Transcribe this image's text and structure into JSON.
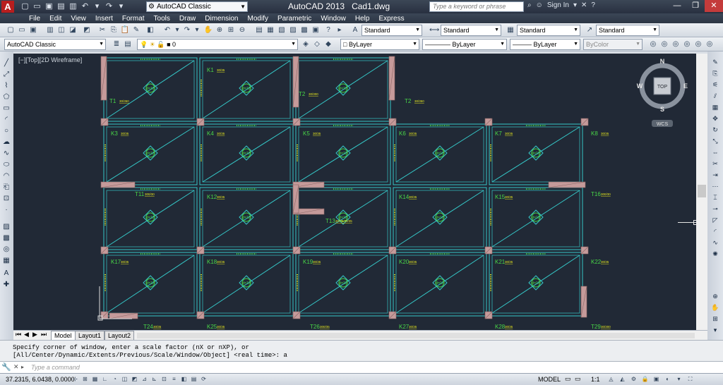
{
  "titlebar": {
    "app_logo": "A",
    "workspace": "AutoCAD Classic",
    "app_name": "AutoCAD 2013",
    "doc_name": "Cad1.dwg",
    "search_placeholder": "Type a keyword or phrase",
    "sign_in": "Sign In"
  },
  "menu": [
    "File",
    "Edit",
    "View",
    "Insert",
    "Format",
    "Tools",
    "Draw",
    "Dimension",
    "Modify",
    "Parametric",
    "Window",
    "Help",
    "Express"
  ],
  "toolbar": {
    "text_style": "Standard",
    "dim_style": "Standard",
    "table_style": "Standard",
    "mleader_style": "Standard"
  },
  "properties": {
    "workspace": "AutoCAD Classic",
    "layer": "0",
    "color": "ByLayer",
    "linetype": "ByLayer",
    "lineweight": "ByLayer",
    "plot_style": "ByColor"
  },
  "viewport": {
    "label": "[−][Top][2D Wireframe]",
    "viewcube": {
      "top": "TOP",
      "n": "N",
      "s": "S",
      "e": "E",
      "w": "W",
      "wcs": "WCS"
    },
    "colors": {
      "background": "#212936",
      "beam": "#35c8c8",
      "column": "#c59a9a",
      "slab_label": "#49d648",
      "annotation": "#e6e61e"
    }
  },
  "tabs": [
    "Model",
    "Layout1",
    "Layout2"
  ],
  "command": {
    "history": [
      "Specify corner of window, enter a scale factor (nX or nXP), or",
      "[All/Center/Dynamic/Extents/Previous/Scale/Window/Object] <real time>: a"
    ],
    "placeholder": "Type a command"
  },
  "status": {
    "coords": "37.2315, 6.0438, 0.0000",
    "space": "MODEL",
    "scale": "1:1"
  },
  "plan": {
    "slabs": [
      {
        "id": "T1",
        "dim": "30/350"
      },
      {
        "id": "K1",
        "dim": "30/35"
      },
      {
        "id": "T2",
        "dim": "30/300"
      },
      {
        "id": "T2",
        "dim": "30/350"
      },
      {
        "id": "K3",
        "dim": "30/35"
      },
      {
        "id": "K4",
        "dim": "30/35"
      },
      {
        "id": "K5",
        "dim": "30/35"
      },
      {
        "id": "K6",
        "dim": "30/35"
      },
      {
        "id": "K7",
        "dim": "30/35"
      },
      {
        "id": "K8",
        "dim": "30/35"
      },
      {
        "id": "T11",
        "dim": "300/30"
      },
      {
        "id": "K12",
        "dim": "30/35"
      },
      {
        "id": "T13",
        "dim": "30/35/30/35"
      },
      {
        "id": "K14",
        "dim": "30/35"
      },
      {
        "id": "K15",
        "dim": "30/35"
      },
      {
        "id": "T16",
        "dim": "300/30"
      },
      {
        "id": "K17",
        "dim": "30/35"
      },
      {
        "id": "K18",
        "dim": "30/35"
      },
      {
        "id": "K19",
        "dim": "30/35"
      },
      {
        "id": "K20",
        "dim": "30/35"
      },
      {
        "id": "K21",
        "dim": "30/35"
      },
      {
        "id": "K22",
        "dim": "30/35"
      },
      {
        "id": "T24",
        "dim": "30/35"
      },
      {
        "id": "K25",
        "dim": "30/35"
      },
      {
        "id": "T26",
        "dim": "300/35"
      },
      {
        "id": "K27",
        "dim": "30/35"
      },
      {
        "id": "K28",
        "dim": "30/35"
      },
      {
        "id": "T29",
        "dim": "30/300"
      }
    ],
    "panel_tag": "d=12"
  }
}
